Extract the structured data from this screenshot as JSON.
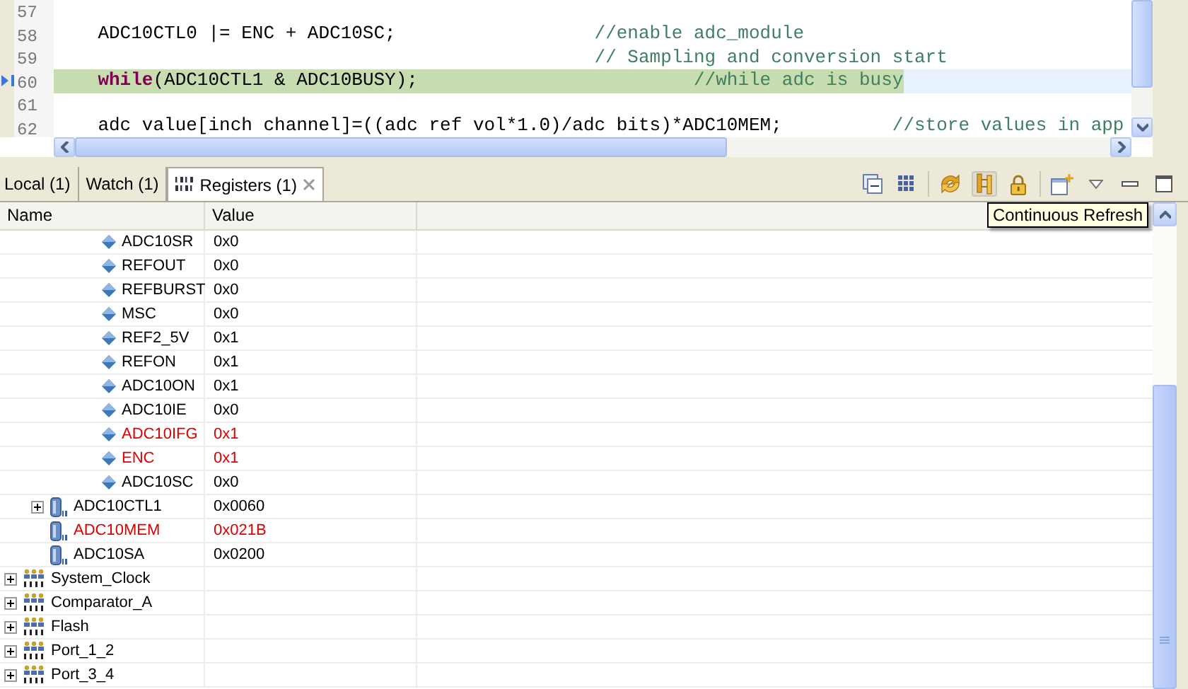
{
  "editor": {
    "lines": [
      {
        "number": "57",
        "debug_current": false
      },
      {
        "number": "58",
        "debug_current": false,
        "segments": [
          {
            "kind": "code",
            "text": "    ADC10CTL0 |= ENC + ADC10SC;"
          },
          {
            "kind": "comment",
            "text": "                  //enable adc_module"
          }
        ]
      },
      {
        "number": "59",
        "debug_current": false,
        "segments": [
          {
            "kind": "comment",
            "text": "                                                 // Sampling and conversion start"
          }
        ]
      },
      {
        "number": "60",
        "debug_current": true,
        "segments": [
          {
            "kind": "keyword",
            "text": "    while"
          },
          {
            "kind": "code",
            "text": "(ADC10CTL1 & ADC10BUSY);"
          },
          {
            "kind": "comment",
            "text": "                         //while adc is busy"
          }
        ]
      },
      {
        "number": "61",
        "debug_current": false
      },
      {
        "number": "62",
        "debug_current": false,
        "segments": [
          {
            "kind": "code",
            "text": "    adc value[inch channel]=((adc ref vol*1.0)/adc bits)*ADC10MEM;"
          },
          {
            "kind": "comment",
            "text": "          //store values in app"
          }
        ]
      }
    ]
  },
  "tabs": [
    {
      "label": "Local (1)",
      "selected": false,
      "icon": false,
      "closable": false
    },
    {
      "label": "Watch (1)",
      "selected": false,
      "icon": false,
      "closable": false
    },
    {
      "label": "Registers (1)",
      "selected": true,
      "icon": true,
      "closable": true
    }
  ],
  "tooltip": "Continuous Refresh",
  "table": {
    "columns": [
      "Name",
      "Value"
    ],
    "rows": [
      {
        "kind": "bit",
        "name": "ADC10SR",
        "value": "0x0",
        "changed": false,
        "expander": false
      },
      {
        "kind": "bit",
        "name": "REFOUT",
        "value": "0x0",
        "changed": false,
        "expander": false
      },
      {
        "kind": "bit",
        "name": "REFBURST",
        "value": "0x0",
        "changed": false,
        "expander": false
      },
      {
        "kind": "bit",
        "name": "MSC",
        "value": "0x0",
        "changed": false,
        "expander": false
      },
      {
        "kind": "bit",
        "name": "REF2_5V",
        "value": "0x1",
        "changed": false,
        "expander": false
      },
      {
        "kind": "bit",
        "name": "REFON",
        "value": "0x1",
        "changed": false,
        "expander": false
      },
      {
        "kind": "bit",
        "name": "ADC10ON",
        "value": "0x1",
        "changed": false,
        "expander": false
      },
      {
        "kind": "bit",
        "name": "ADC10IE",
        "value": "0x0",
        "changed": false,
        "expander": false
      },
      {
        "kind": "bit",
        "name": "ADC10IFG",
        "value": "0x1",
        "changed": true,
        "expander": false
      },
      {
        "kind": "bit",
        "name": "ENC",
        "value": "0x1",
        "changed": true,
        "expander": false
      },
      {
        "kind": "bit",
        "name": "ADC10SC",
        "value": "0x0",
        "changed": false,
        "expander": false
      },
      {
        "kind": "register",
        "name": "ADC10CTL1",
        "value": "0x0060",
        "changed": false,
        "expander": true
      },
      {
        "kind": "register",
        "name": "ADC10MEM",
        "value": "0x021B",
        "changed": true,
        "expander": false
      },
      {
        "kind": "register",
        "name": "ADC10SA",
        "value": "0x0200",
        "changed": false,
        "expander": false
      },
      {
        "kind": "group",
        "name": "System_Clock",
        "changed": false,
        "expander": true
      },
      {
        "kind": "group",
        "name": "Comparator_A",
        "changed": false,
        "expander": true
      },
      {
        "kind": "group",
        "name": "Flash",
        "changed": false,
        "expander": true
      },
      {
        "kind": "group",
        "name": "Port_1_2",
        "changed": false,
        "expander": true
      },
      {
        "kind": "group",
        "name": "Port_3_4",
        "changed": false,
        "expander": true
      }
    ]
  }
}
